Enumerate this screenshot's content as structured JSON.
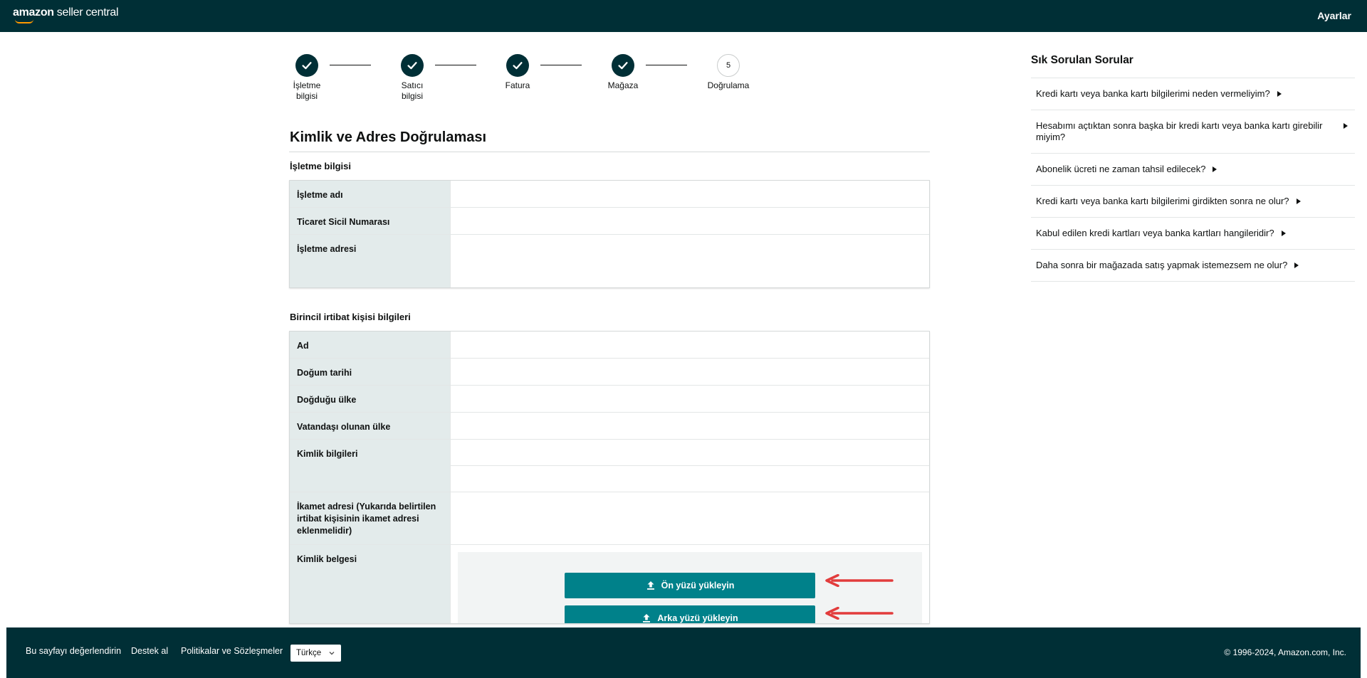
{
  "header": {
    "logo_brand": "amazon",
    "logo_product": "seller central",
    "settings_label": "Ayarlar"
  },
  "stepper": {
    "steps": [
      {
        "label": "İşletme bilgisi",
        "state": "complete"
      },
      {
        "label": "Satıcı bilgisi",
        "state": "complete"
      },
      {
        "label": "Fatura",
        "state": "complete"
      },
      {
        "label": "Mağaza",
        "state": "complete"
      },
      {
        "label": "Doğrulama",
        "state": "current",
        "number": "5"
      }
    ]
  },
  "main": {
    "title": "Kimlik ve Adres Doğrulaması",
    "business_section": {
      "title": "İşletme bilgisi",
      "rows": [
        "İşletme adı",
        "Ticaret Sicil Numarası",
        "İşletme adresi"
      ]
    },
    "contact_section": {
      "title": "Birincil irtibat kişisi bilgileri",
      "rows": {
        "name": "Ad",
        "birth_date": "Doğum tarihi",
        "birth_country": "Doğduğu ülke",
        "citizenship": "Vatandaşı olunan ülke",
        "id_info": "Kimlik bilgileri",
        "residence": "İkamet adresi (Yukarıda belirtilen irtibat kişisinin ikamet adresi eklenmelidir)",
        "id_document": "Kimlik belgesi"
      },
      "upload_front": "Ön yüzü yükleyin",
      "upload_back": "Arka yüzü yükleyin"
    }
  },
  "faq": {
    "title": "Sık Sorulan Sorular",
    "items": [
      "Kredi kartı veya banka kartı bilgilerimi neden vermeliyim?",
      "Hesabımı açtıktan sonra başka bir kredi kartı veya banka kartı girebilir miyim?",
      "Abonelik ücreti ne zaman tahsil edilecek?",
      "Kredi kartı veya banka kartı bilgilerimi girdikten sonra ne olur?",
      "Kabul edilen kredi kartları veya banka kartları hangileridir?",
      "Daha sonra bir mağazada satış yapmak istemezsem ne olur?"
    ]
  },
  "footer": {
    "links": [
      "Bu sayfayı değerlendirin",
      "Destek al",
      "Politikalar ve Sözleşmeler"
    ],
    "language": "Türkçe",
    "copyright": "© 1996-2024, Amazon.com, Inc."
  },
  "colors": {
    "header_bg": "#002f36",
    "label_bg": "#e3ebeb",
    "upload_btn": "#00818a",
    "annotation_arrow": "#e23c3c"
  }
}
